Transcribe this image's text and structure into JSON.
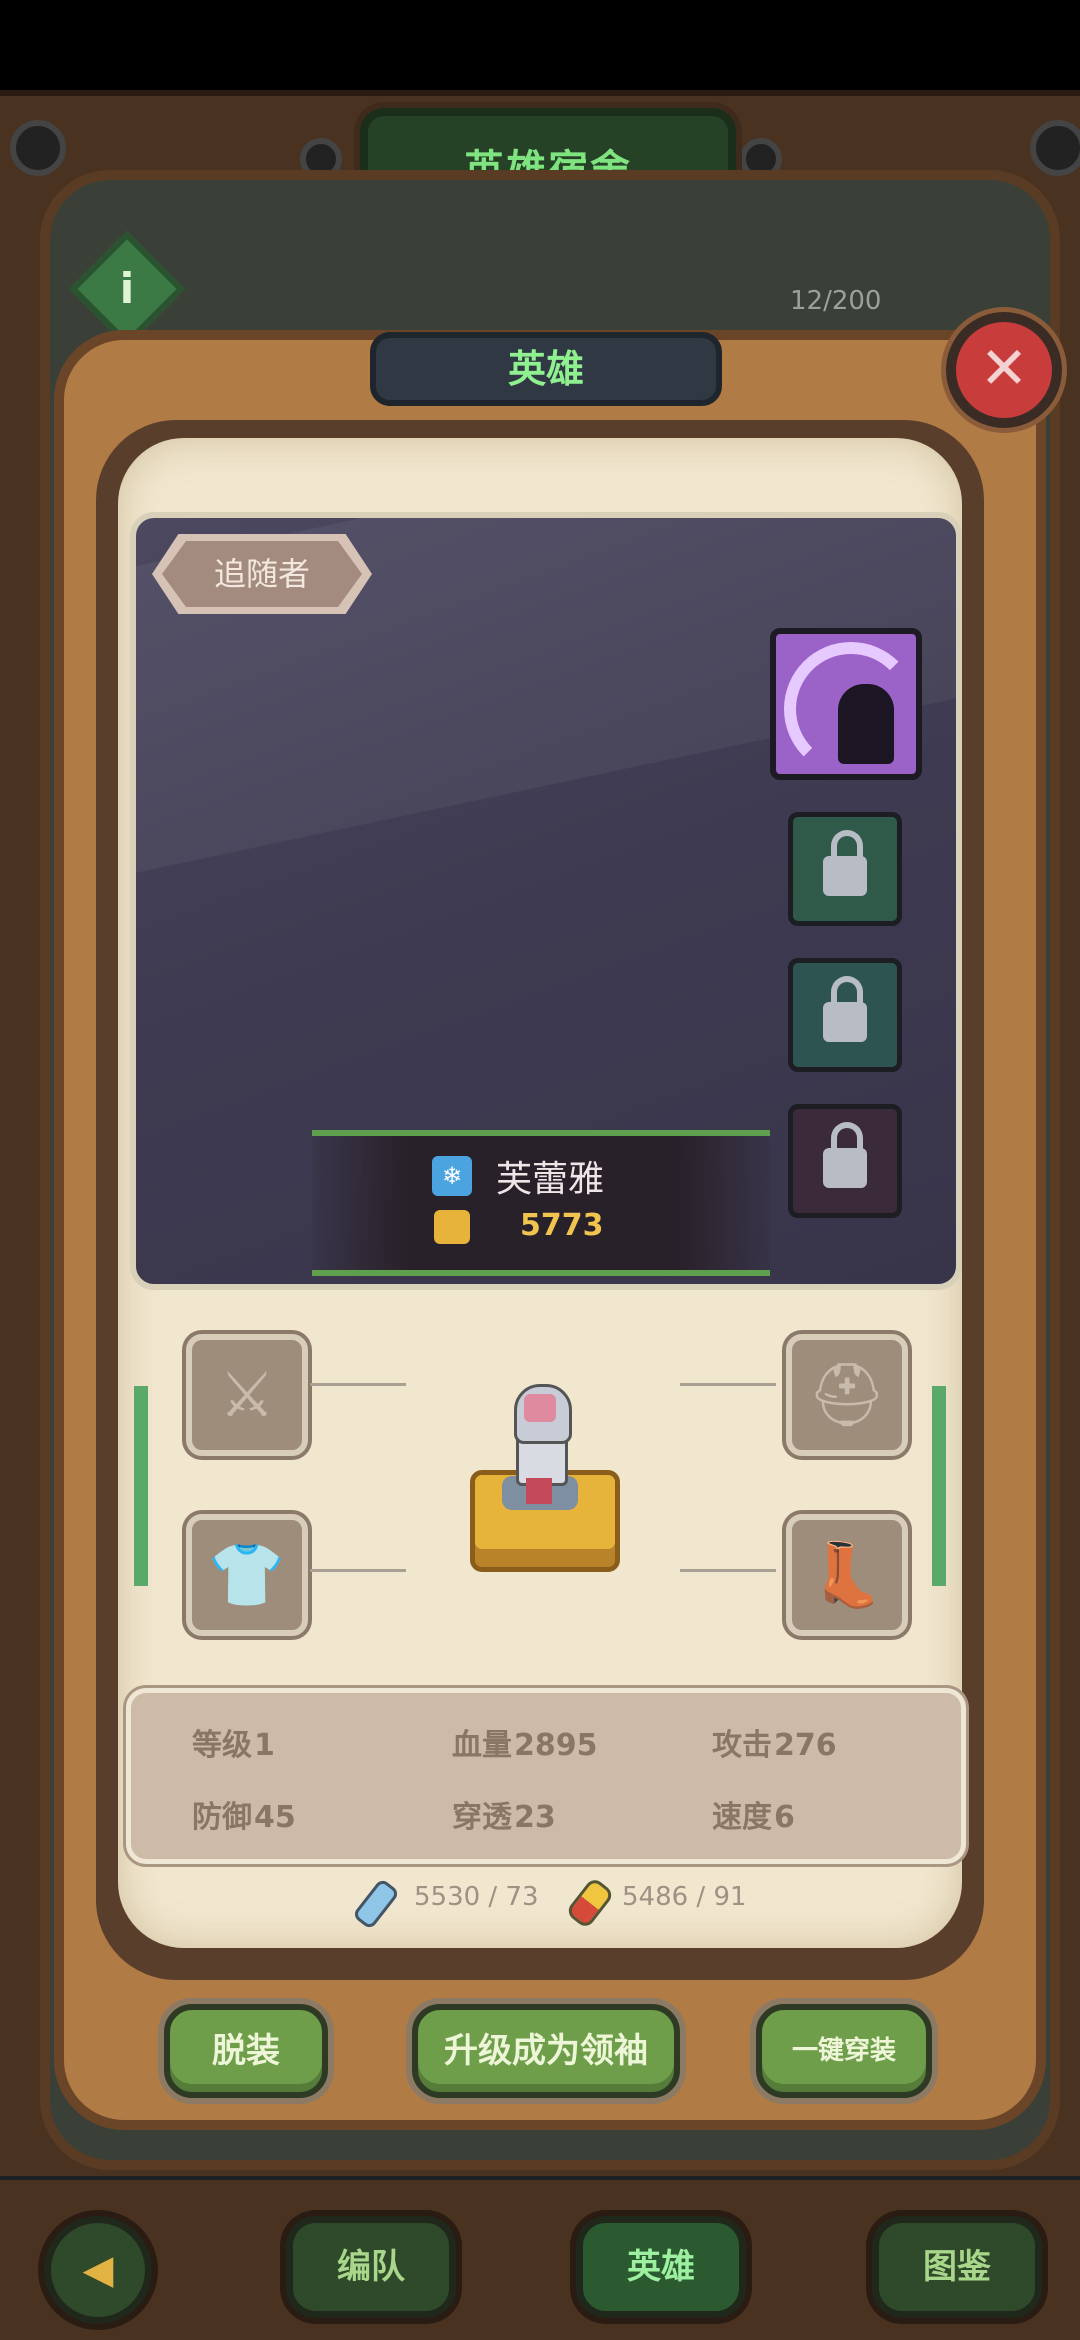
{
  "header": {
    "title": "英雄宿舍",
    "count": "12/200"
  },
  "panel": {
    "tab_title": "英雄",
    "close_label": "✕"
  },
  "hero": {
    "rank": "追随者",
    "name": "芙蕾雅",
    "power": "5773",
    "element_icon": "ice-element-icon"
  },
  "skills": [
    {
      "name": "shadow-skill-icon",
      "locked": false
    },
    {
      "name": "locked-skill-1",
      "locked": true
    },
    {
      "name": "locked-skill-2",
      "locked": true
    },
    {
      "name": "locked-skill-3",
      "locked": true
    }
  ],
  "equipment": [
    "weapon-slot",
    "helmet-slot",
    "armor-slot",
    "boots-slot"
  ],
  "stats": {
    "level": {
      "label": "等级",
      "value": "1"
    },
    "hp": {
      "label": "血量",
      "value": "2895"
    },
    "attack": {
      "label": "攻击",
      "value": "276"
    },
    "defense": {
      "label": "防御",
      "value": "45"
    },
    "penetration": {
      "label": "穿透",
      "value": "23"
    },
    "speed": {
      "label": "速度",
      "value": "6"
    }
  },
  "resources": {
    "potion": "5530 / 73",
    "pill": "5486 / 91"
  },
  "actions": {
    "unequip": "脱装",
    "upgrade": "升级成为领袖",
    "equip_all": "一键穿装"
  },
  "nav": {
    "team": "编队",
    "hero": "英雄",
    "codex": "图鉴",
    "back": "◀"
  },
  "colors": {
    "accent_green": "#7fe37f",
    "close_red": "#c83c3c",
    "power_gold": "#f1c44f"
  }
}
